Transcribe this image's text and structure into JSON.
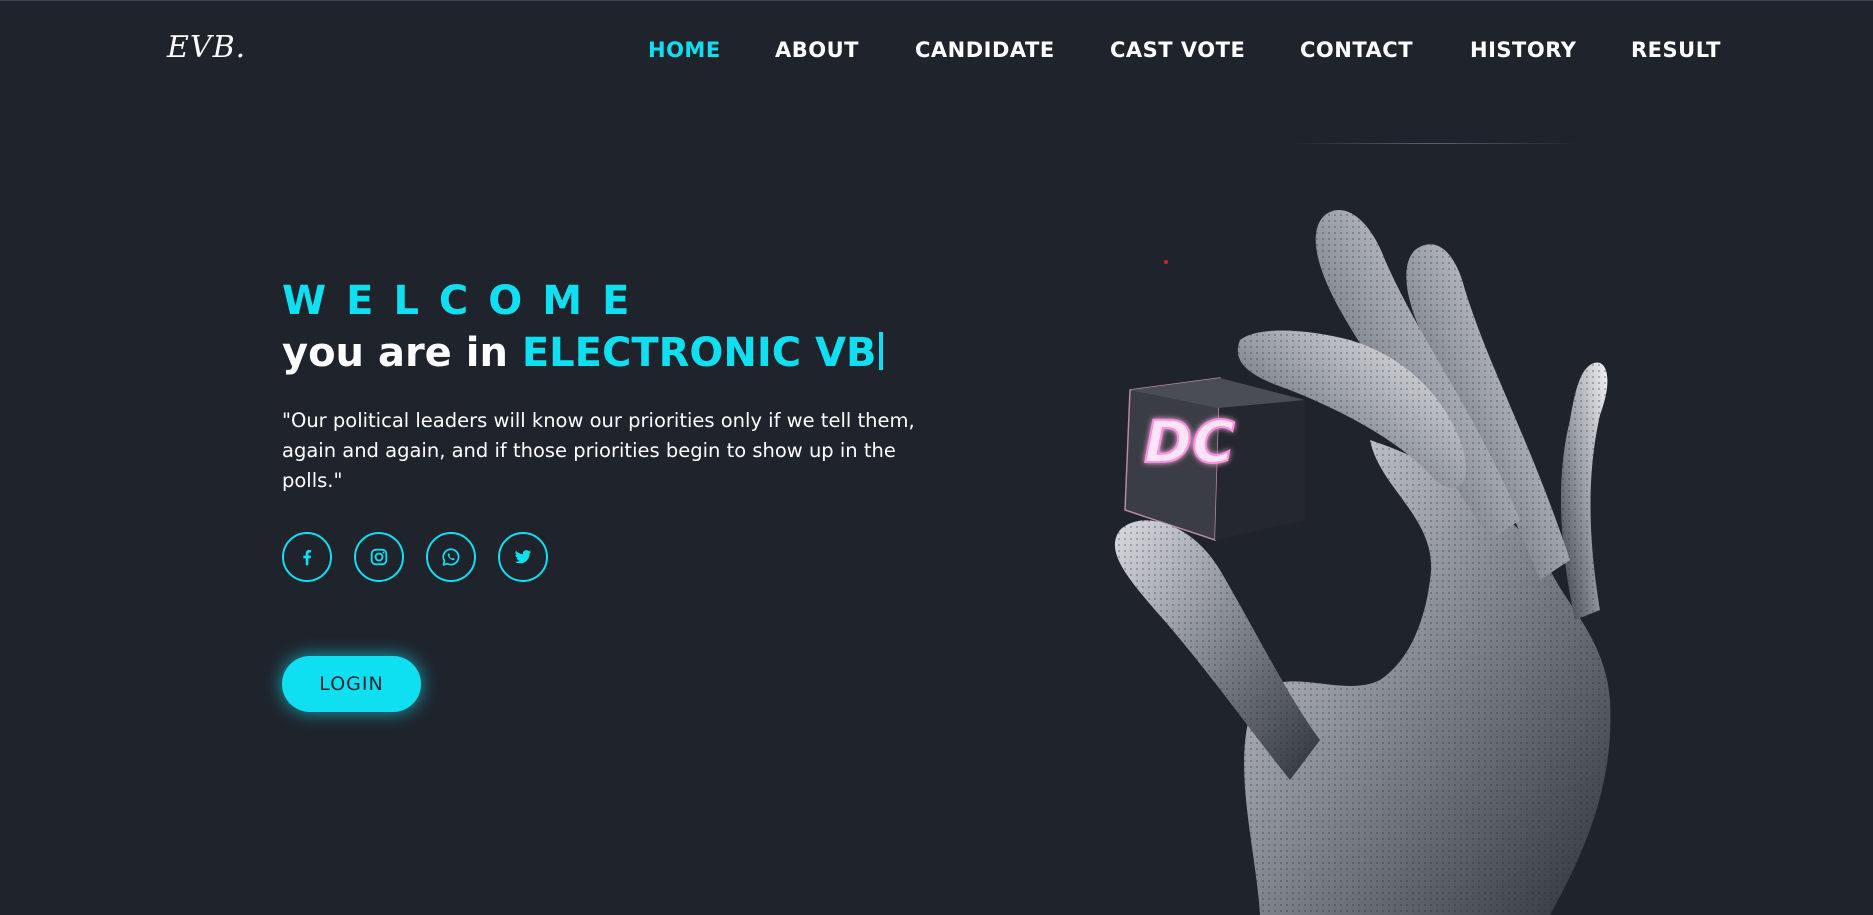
{
  "header": {
    "logo": "EVB."
  },
  "nav": {
    "items": [
      {
        "label": "HOME",
        "active": true
      },
      {
        "label": "ABOUT"
      },
      {
        "label": "CANDIDATE"
      },
      {
        "label": "CAST VOTE"
      },
      {
        "label": "CONTACT"
      },
      {
        "label": "HISTORY"
      },
      {
        "label": "RESULT"
      }
    ]
  },
  "hero": {
    "welcome": "WELCOME",
    "headline_prefix": "you are in ",
    "headline_accent": "ELECTRONIC VB",
    "quote": "\"Our political leaders will know our priorities only if we tell them, again and again, and if those priorities begin to show up in the polls.\"",
    "login_label": "LOGIN",
    "cube_text": "DC"
  },
  "social": [
    {
      "icon": "facebook-icon"
    },
    {
      "icon": "instagram-icon"
    },
    {
      "icon": "whatsapp-icon"
    },
    {
      "icon": "twitter-icon"
    }
  ],
  "colors": {
    "background": "#1f232c",
    "accent": "#0ee0f2",
    "text": "#ffffff",
    "cube_glow": "#ff9ee6"
  }
}
